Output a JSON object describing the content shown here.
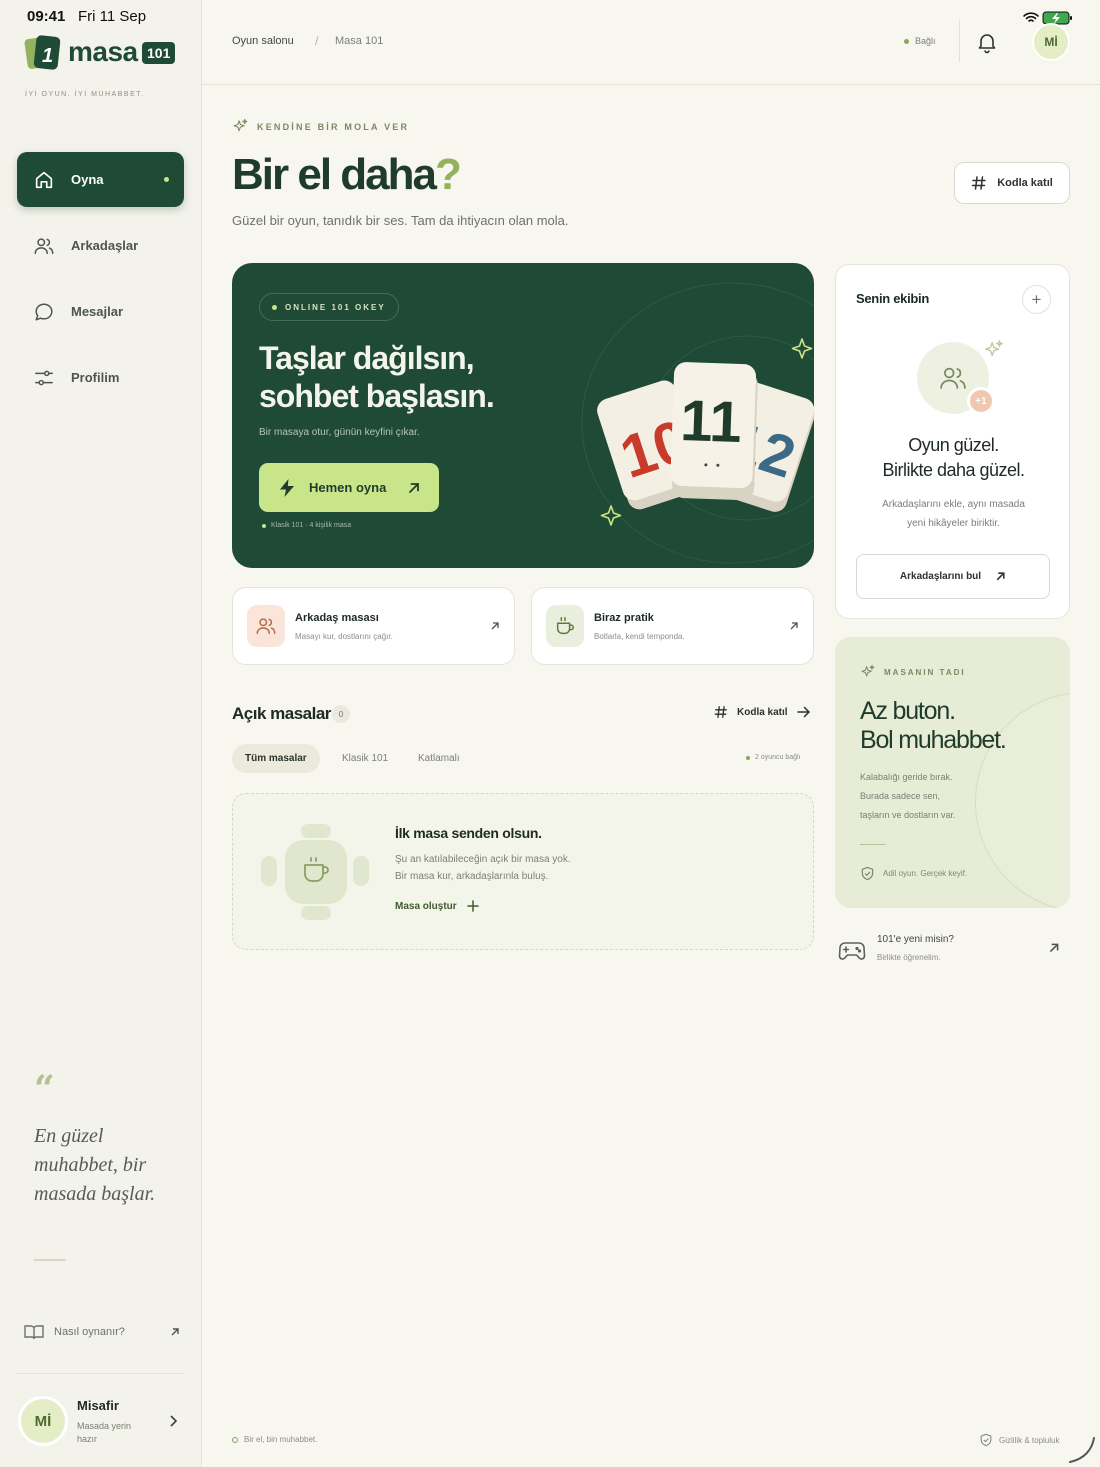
{
  "status_bar": {
    "time": "09:41",
    "date": "Fri 11 Sep"
  },
  "brand": {
    "logo_digit": "1",
    "name": "masa",
    "badge": "101",
    "tagline": "İYİ OYUN. İYİ MUHABBET."
  },
  "sidebar": {
    "items": [
      {
        "label": "Oyna",
        "icon": "home-icon",
        "active": true
      },
      {
        "label": "Arkadaşlar",
        "icon": "users-icon"
      },
      {
        "label": "Mesajlar",
        "icon": "message-icon"
      },
      {
        "label": "Profilim",
        "icon": "sliders-icon"
      }
    ],
    "quote_mark": "“",
    "quote": "En güzel muhabbet, bir masada başlar.",
    "howto": "Nasıl oynanır?",
    "user": {
      "initials": "Mİ",
      "name": "Misafir",
      "status": "Masada yerin hazır"
    }
  },
  "topbar": {
    "breadcrumb": [
      "Oyun salonu",
      "/",
      "Masa 101"
    ],
    "connection": "Bağlı",
    "avatar": "Mİ"
  },
  "header": {
    "eyebrow": "KENDİNE BİR MOLA VER",
    "title": "Bir el daha",
    "title_mark": "?",
    "subtitle": "Güzel bir oyun, tanıdık bir ses. Tam da ihtiyacın olan mola.",
    "code_button": "Kodla katıl"
  },
  "hero": {
    "pill": "ONLINE 101 OKEY",
    "title_line1": "Taşlar dağılsın,",
    "title_line2": "sohbet başlasın.",
    "subtitle": "Bir masaya otur, günün keyfini çıkar.",
    "cta": "Hemen oyna",
    "meta": "Klasik 101 · 4 kişilik masa",
    "tiles": [
      "10",
      "11",
      "12"
    ]
  },
  "quick_cards": [
    {
      "title": "Arkadaş masası",
      "subtitle": "Masayı kur, dostlarını çağır.",
      "icon": "users-icon"
    },
    {
      "title": "Biraz pratik",
      "subtitle": "Botlarla, kendi temponda.",
      "icon": "coffee-icon"
    }
  ],
  "open_tables": {
    "title": "Açık masalar",
    "count": "0",
    "code_link": "Kodla katıl",
    "filters": [
      "Tüm masalar",
      "Klasik 101",
      "Katlamalı"
    ],
    "online": "2 oyuncu bağlı",
    "empty": {
      "title": "İlk masa senden olsun.",
      "line1": "Şu an katılabileceğin açık bir masa yok.",
      "line2": "Bir masa kur, arkadaşlarınla buluş.",
      "button": "Masa oluştur"
    }
  },
  "team": {
    "title": "Senin ekibin",
    "add": "+",
    "plus_badge": "+1",
    "heading_line1": "Oyun güzel.",
    "heading_line2": "Birlikte daha güzel.",
    "text_line1": "Arkadaşlarını ekle, aynı masada",
    "text_line2": "yeni hikâyeler biriktir.",
    "button": "Arkadaşlarını bul"
  },
  "taste": {
    "eyebrow": "MASANIN TADI",
    "heading_line1": "Az buton.",
    "heading_line2": "Bol muhabbet.",
    "p1": "Kalabalığı geride bırak.",
    "p2": "Burada sadece sen,",
    "p3": "taşların ve dostların var.",
    "footer": "Adil oyun. Gerçek keyif."
  },
  "new_to": {
    "title": "101'e yeni misin?",
    "subtitle": "Birlikte öğrenelim."
  },
  "footer": {
    "left": "Bir el, bin muhabbet.",
    "right": "Gizlilik & topluluk"
  },
  "colors": {
    "brand": "#1f4a36",
    "accent": "#c8e58a",
    "accent_dark": "#93b25e",
    "background": "#f7f6ef"
  }
}
